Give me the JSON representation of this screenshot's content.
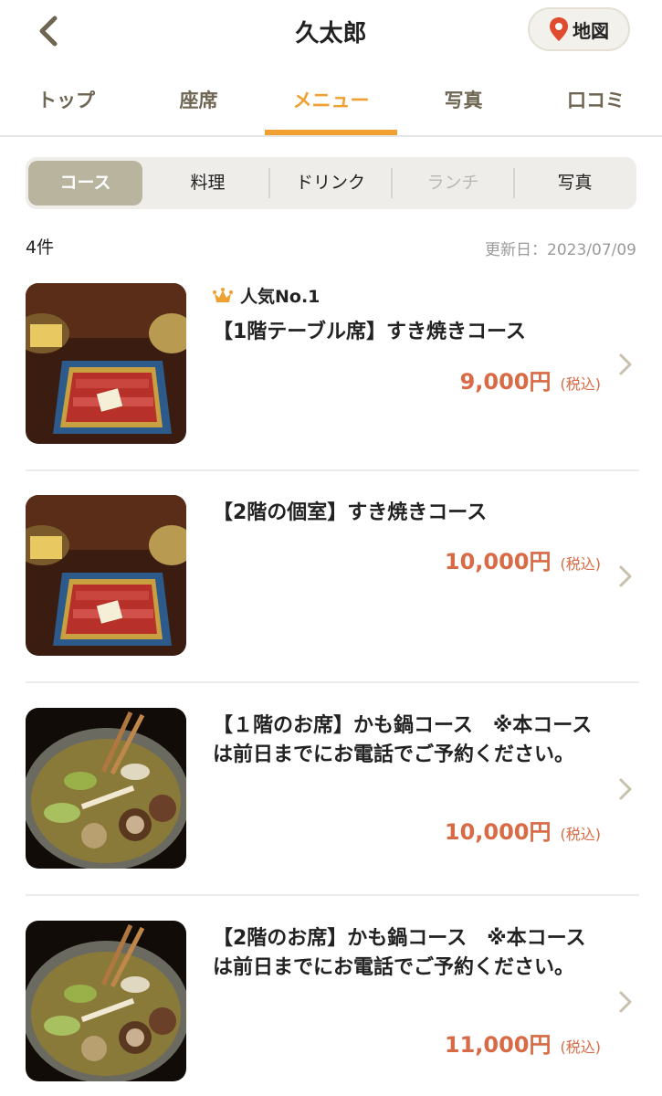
{
  "header": {
    "title": "久太郎",
    "map_label": "地図"
  },
  "main_tabs": [
    {
      "label": "トップ"
    },
    {
      "label": "座席"
    },
    {
      "label": "メニュー",
      "active": true
    },
    {
      "label": "写真"
    },
    {
      "label": "口コミ"
    }
  ],
  "sub_tabs": [
    {
      "label": "コース",
      "active": true
    },
    {
      "label": "料理"
    },
    {
      "label": "ドリンク"
    },
    {
      "label": "ランチ",
      "disabled": true
    },
    {
      "label": "写真"
    }
  ],
  "meta": {
    "count": "4件",
    "updated": "更新日：2023/07/09"
  },
  "items": [
    {
      "badge": "人気No.1",
      "title": "【1階テーブル席】すき焼きコース",
      "price": "9,000円",
      "tax": "(税込)",
      "thumb_icon": "sukiyaki-photo"
    },
    {
      "title": "【2階の個室】すき焼きコース",
      "price": "10,000円",
      "tax": "(税込)",
      "thumb_icon": "sukiyaki-photo"
    },
    {
      "title": "【１階のお席】かも鍋コース　※本コースは前日までにお電話でご予約ください。",
      "price": "10,000円",
      "tax": "(税込)",
      "thumb_icon": "kamonabe-photo"
    },
    {
      "title": "【2階のお席】かも鍋コース　※本コースは前日までにお電話でご予約ください。",
      "price": "11,000円",
      "tax": "(税込)",
      "thumb_icon": "kamonabe-photo"
    }
  ],
  "colors": {
    "accent": "#f0a030",
    "price": "#d86a45",
    "active_subtab": "#b9b49e"
  }
}
